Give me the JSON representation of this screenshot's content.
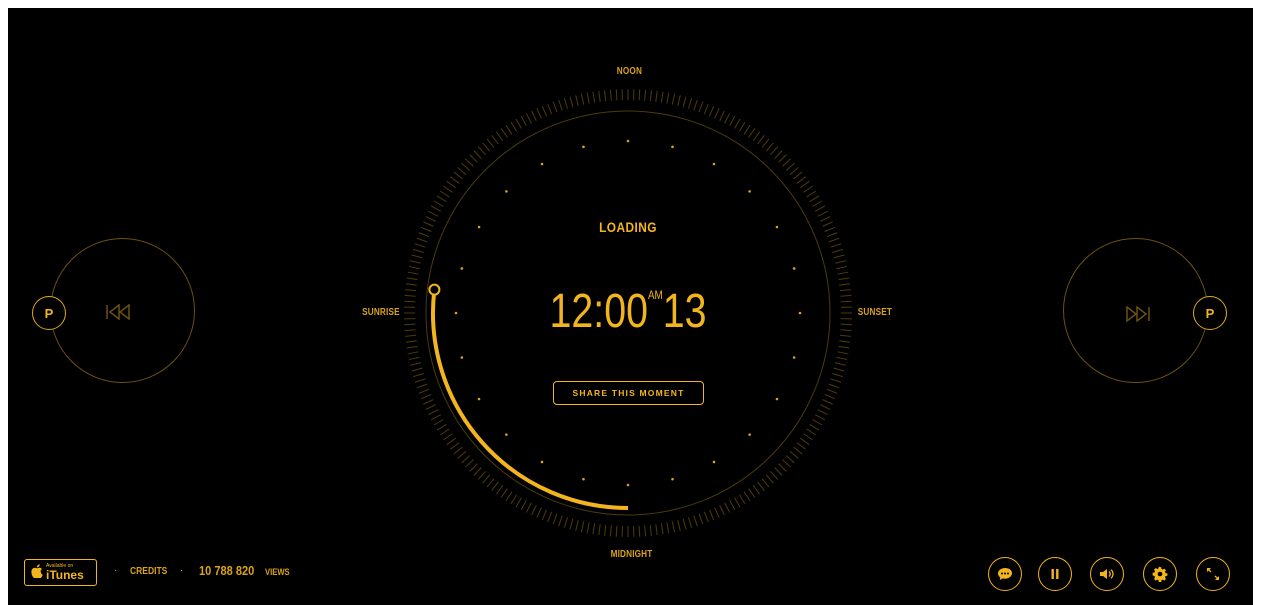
{
  "dial": {
    "noon": "NOON",
    "midnight": "MIDNIGHT",
    "sunrise": "SUNRISE",
    "sunset": "SUNSET",
    "progress_fraction": 0.25
  },
  "status": "LOADING",
  "clock": {
    "time": "12:00",
    "ampm": "AM",
    "seconds": "13"
  },
  "share_label": "SHARE THIS MOMENT",
  "player": {
    "prev_label": "P",
    "next_label": "P"
  },
  "footer": {
    "itunes_small": "Available on",
    "itunes_big": "iTunes",
    "credits": "CREDITS",
    "views_count": "10 788 820",
    "views_label": "VIEWS"
  },
  "controls": [
    "chat-icon",
    "pause-icon",
    "volume-icon",
    "gear-icon",
    "fullscreen-icon"
  ],
  "colors": {
    "accent": "#f3b51d",
    "dim": "#6b5112",
    "background": "#000000"
  }
}
